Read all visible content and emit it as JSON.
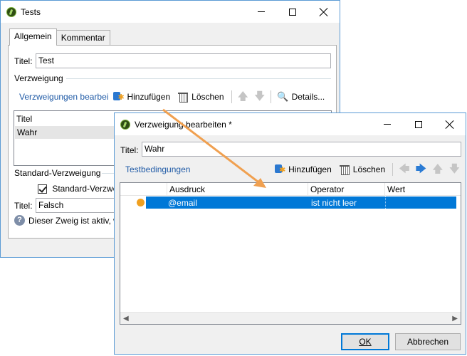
{
  "tests_window": {
    "title": "Tests",
    "tabs": [
      "Allgemein",
      "Kommentar"
    ],
    "titel_label": "Titel:",
    "titel_value": "Test",
    "verzweigung_label": "Verzweigung",
    "toolbar": {
      "edit_link": "Verzweigungen bearbei",
      "add": "Hinzufügen",
      "delete": "Löschen",
      "details": "Details..."
    },
    "branches_list": {
      "header": "Titel",
      "rows": [
        "Wahr"
      ]
    },
    "standard_label": "Standard-Verzweigung",
    "standard_checkbox": "Standard-Verzwei",
    "standard_titel_label": "Titel:",
    "standard_titel_value": "Falsch",
    "info_text": "Dieser Zweig ist aktiv, w"
  },
  "edit_dialog": {
    "title": "Verzweigung bearbeiten *",
    "titel_label": "Titel:",
    "titel_value": "Wahr",
    "toolbar": {
      "test_link": "Testbedingungen",
      "add": "Hinzufügen",
      "delete": "Löschen"
    },
    "grid": {
      "columns": [
        "Ausdruck",
        "Operator",
        "Wert"
      ],
      "rows": [
        {
          "ausdruck": "@email",
          "operator": "ist nicht leer",
          "wert": ""
        }
      ]
    },
    "ok": "OK",
    "cancel": "Abbrechen"
  },
  "colors": {
    "selection": "#0078d7",
    "link": "#1f5aa6",
    "annotation_arrow": "#f0a050",
    "status_dot": "#f0a020"
  }
}
